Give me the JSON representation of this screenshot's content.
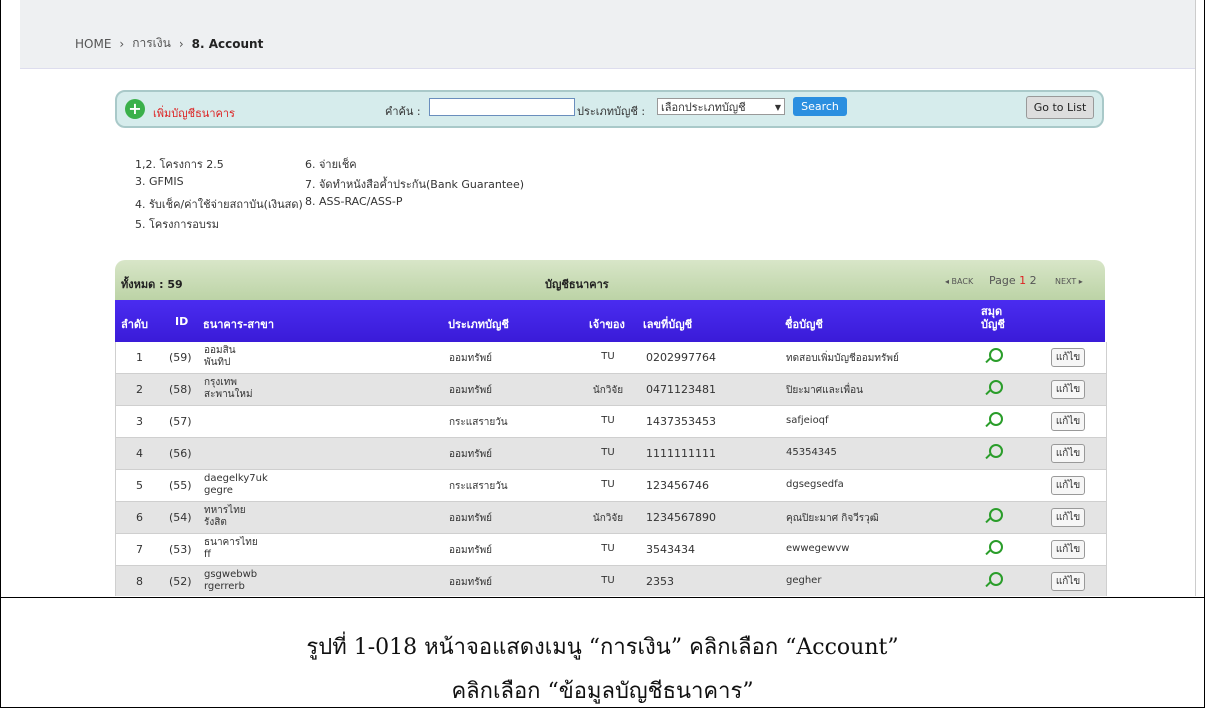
{
  "breadcrumb": {
    "home": "HOME",
    "sep": "›",
    "level1": "การเงิน",
    "current": "8. Account"
  },
  "searchbar": {
    "add_label": "เพิ่มบัญชีธนาคาร",
    "keyword_label": "คำค้น :",
    "keyword_value": "",
    "type_label": "ประเภทบัญชี :",
    "type_selected": "เลือกประเภทบัญชี",
    "search_button": "Search",
    "goto_button": "Go to List"
  },
  "legend": [
    "1,2. โครงการ 2.5",
    "3. GFMIS",
    "4. รับเช็ค/ค่าใช้จ่ายสถาบัน(เงินสด)",
    "5. โครงการอบรม",
    "6. จ่ายเช็ค",
    "7. จัดทำหนังสือค้ำประกัน(Bank Guarantee)",
    "8. ASS-RAC/ASS-P"
  ],
  "table": {
    "total": "ทั้งหมด : 59",
    "title": "บัญชีธนาคาร",
    "back": "◂ BACK",
    "page_label": "Page",
    "page_current": "1",
    "page_other": "2",
    "next": "NEXT ▸",
    "headers": {
      "no": "ลำดับ",
      "id": "ID",
      "bank": "ธนาคาร-สาขา",
      "type": "ประเภทบัญชี",
      "owner": "เจ้าของ",
      "acc_no": "เลขที่บัญชี",
      "acc_name": "ชื่อบัญชี",
      "book": "สมุด บัญชี"
    },
    "edit_label": "แก้ไข",
    "rows": [
      {
        "no": "1",
        "id": "(59)",
        "bank1": "ออมสิน",
        "bank2": "พันทิป",
        "type": "ออมทรัพย์",
        "owner": "TU",
        "acc_no": "0202997764",
        "acc_name": "ทดสอบเพิ่มบัญชีออมทรัพย์",
        "book": true
      },
      {
        "no": "2",
        "id": "(58)",
        "bank1": "กรุงเทพ",
        "bank2": "สะพานใหม่",
        "type": "ออมทรัพย์",
        "owner": "นักวิจัย",
        "acc_no": "0471123481",
        "acc_name": "ปิยะมาศและเพื่อน",
        "book": true
      },
      {
        "no": "3",
        "id": "(57)",
        "bank1": "",
        "bank2": "",
        "type": "กระแสรายวัน",
        "owner": "TU",
        "acc_no": "1437353453",
        "acc_name": "safjeioqf",
        "book": true
      },
      {
        "no": "4",
        "id": "(56)",
        "bank1": "",
        "bank2": "",
        "type": "ออมทรัพย์",
        "owner": "TU",
        "acc_no": "1111111111",
        "acc_name": "45354345",
        "book": true
      },
      {
        "no": "5",
        "id": "(55)",
        "bank1": "daegelky7uk",
        "bank2": "gegre",
        "type": "กระแสรายวัน",
        "owner": "TU",
        "acc_no": "123456746",
        "acc_name": "dgsegsedfa",
        "book": false
      },
      {
        "no": "6",
        "id": "(54)",
        "bank1": "ทหารไทย",
        "bank2": "รังสิต",
        "type": "ออมทรัพย์",
        "owner": "นักวิจัย",
        "acc_no": "1234567890",
        "acc_name": "คุณปิยะมาศ กิจวีรวุฒิ",
        "book": true
      },
      {
        "no": "7",
        "id": "(53)",
        "bank1": "ธนาคารไทย",
        "bank2": "ff",
        "type": "ออมทรัพย์",
        "owner": "TU",
        "acc_no": "3543434",
        "acc_name": "ewwegewvw",
        "book": true
      },
      {
        "no": "8",
        "id": "(52)",
        "bank1": "gsgwebwb",
        "bank2": "rgerrerb",
        "type": "ออมทรัพย์",
        "owner": "TU",
        "acc_no": "2353",
        "acc_name": "gegher",
        "book": true
      }
    ]
  },
  "caption": {
    "line1": "รูปที่ 1-018 หน้าจอแสดงเมนู “การเงิน” คลิกเลือก “Account”",
    "line2": "คลิกเลือก “ข้อมูลบัญชีธนาคาร”"
  },
  "icons": {
    "add": "plus-circle-icon",
    "book": "magnifier-icon",
    "select_caret": "caret-down-icon"
  },
  "colors": {
    "header_blue": "#3a1bd8",
    "header_green": "#bcd3a6",
    "add_text": "#dd2222",
    "search_btn": "#2b8fe0"
  }
}
